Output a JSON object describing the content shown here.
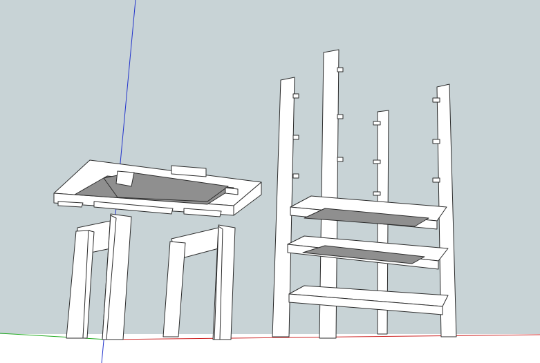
{
  "app": {
    "name": "",
    "window_title": ""
  },
  "viewport": {
    "sky_color": "#c8d3d6",
    "ground_color": "#ffffff",
    "face_color": "#ffffff",
    "shaded_face_color": "#8f8f8f",
    "edge_color": "#2b2b2b",
    "axis_colors": {
      "x_axis": "#cc2222",
      "y_axis": "#22aa22",
      "z_axis": "#2233cc"
    }
  },
  "scene": {
    "objects": [
      {
        "id": "detached-table-top",
        "description_icon": "panel-icon"
      },
      {
        "id": "table-leg-frame-left",
        "description_icon": "frame-icon"
      },
      {
        "id": "table-leg-frame-right",
        "description_icon": "frame-icon"
      },
      {
        "id": "stacked-shelf-tower",
        "description_icon": "shelf-icon"
      }
    ]
  }
}
